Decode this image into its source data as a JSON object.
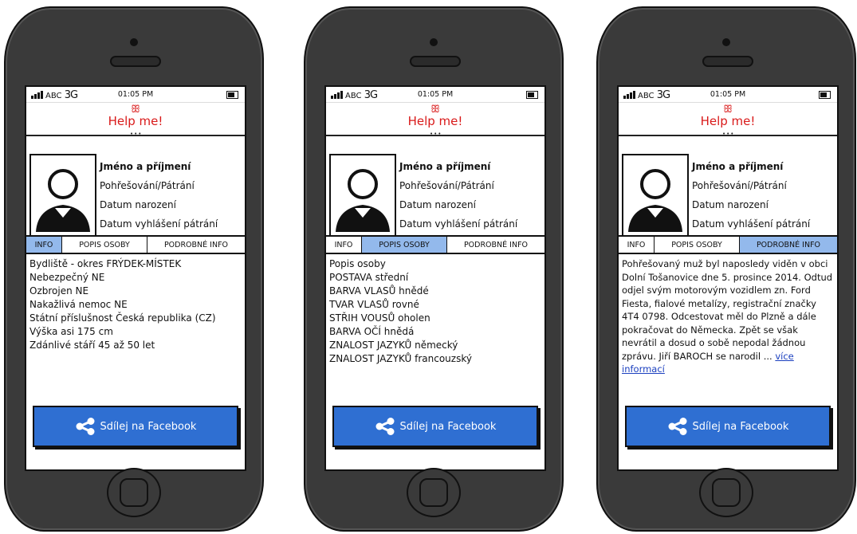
{
  "status": {
    "carrier": "ABC",
    "network": "3G",
    "time": "01:05 PM"
  },
  "app": {
    "logo_glyph": "ꕥ",
    "title": "Help me!",
    "menu_dots": "•••"
  },
  "profile": {
    "name_label": "Jméno a příjmení",
    "status_label": "Pohřešování/Pátrání",
    "birth_label": "Datum narození",
    "declared_label": "Datum vyhlášení pátrání"
  },
  "tabs": {
    "info": "INFO",
    "description": "POPIS OSOBY",
    "details": "PODROBNÉ INFO"
  },
  "info_lines": [
    "Bydliště - okres FRÝDEK-MÍSTEK",
    "Nebezpečný NE",
    "Ozbrojen NE",
    "Nakažlivá nemoc NE",
    "Státní příslušnost Česká republika (CZ)",
    "Výška asi 175 cm",
    "Zdánlivé stáří 45 až 50 let"
  ],
  "description_lines": [
    "Popis osoby",
    "POSTAVA střední",
    "BARVA VLASŮ hnědé",
    "TVAR VLASŮ rovné",
    "STŘIH VOUSŮ oholen",
    "BARVA OČÍ hnědá",
    "ZNALOST JAZYKŮ německý",
    "ZNALOST JAZYKŮ francouzský"
  ],
  "details": {
    "text": "Pohřešovaný muž byl naposledy viděn v obci Dolní Tošanovice dne 5. prosince 2014. Odtud odjel svým motorovým vozidlem zn. Ford Fiesta, fialové metalízy, registrační značky 4T4 0798. Odcestovat měl do Plzně a dále pokračovat do Německa. Zpět se však nevrátil a dosud o sobě nepodal žádnou zprávu. Jiří BAROCH se narodil ... ",
    "more_link": "více informací"
  },
  "share": {
    "label": "Sdílej na Facebook"
  },
  "colors": {
    "accent_red": "#d91a1a",
    "tab_active": "#93b9ec",
    "share_button": "#2f6fd2",
    "phone_body": "#3a3a3a"
  },
  "icons": {
    "logo": "octopus-logo-icon",
    "avatar": "person-avatar-icon",
    "share": "share-nodes-icon",
    "signal": "signal-bars-icon",
    "battery": "battery-icon"
  }
}
